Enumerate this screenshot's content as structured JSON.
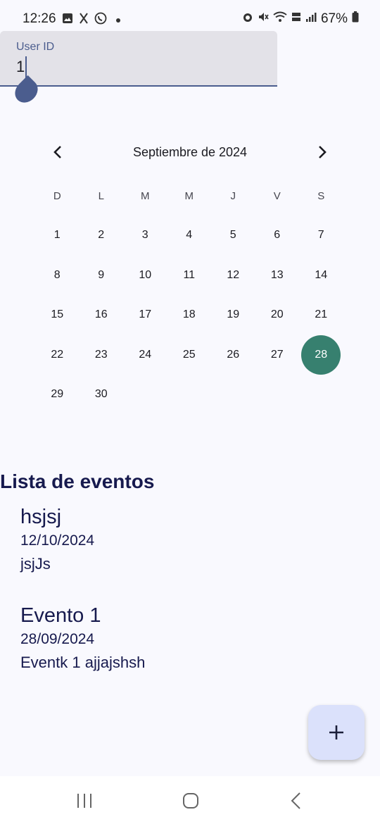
{
  "status_bar": {
    "time": "12:26",
    "battery": "67%",
    "left_icons": [
      "gallery-icon",
      "app-icon",
      "whatsapp-icon"
    ],
    "right_icons": [
      "alarm-icon",
      "mute-icon",
      "wifi-icon",
      "volte-icon",
      "signal-icon",
      "battery-icon"
    ]
  },
  "user_field": {
    "label": "User ID",
    "value": "1"
  },
  "calendar": {
    "month_title": "Septiembre de 2024",
    "weekdays": [
      "D",
      "L",
      "M",
      "M",
      "J",
      "V",
      "S"
    ],
    "weeks": [
      [
        "1",
        "2",
        "3",
        "4",
        "5",
        "6",
        "7"
      ],
      [
        "8",
        "9",
        "10",
        "11",
        "12",
        "13",
        "14"
      ],
      [
        "15",
        "16",
        "17",
        "18",
        "19",
        "20",
        "21"
      ],
      [
        "22",
        "23",
        "24",
        "25",
        "26",
        "27",
        "28"
      ],
      [
        "29",
        "30",
        "",
        "",
        "",
        "",
        ""
      ]
    ],
    "selected_day": "28",
    "accent_color": "#37806f"
  },
  "events": {
    "title": "Lista de eventos",
    "items": [
      {
        "title": "hsjsj",
        "date": "12/10/2024",
        "description": "jsjJs"
      },
      {
        "title": "Evento 1",
        "date": "28/09/2024",
        "description": "Eventk 1 ajjajshsh"
      }
    ]
  },
  "fab": {
    "icon": "plus-icon"
  },
  "nav": {
    "icons": [
      "recent-apps-icon",
      "home-icon",
      "back-icon"
    ]
  }
}
